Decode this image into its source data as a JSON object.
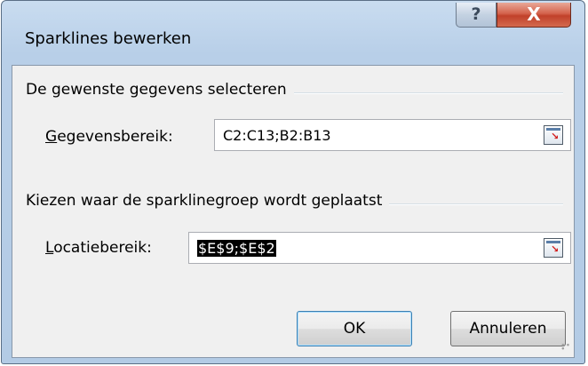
{
  "dialog": {
    "title": "Sparklines bewerken",
    "help_glyph": "?",
    "close_glyph": "X"
  },
  "data_group": {
    "heading": "De gewenste gegevens selecteren",
    "range_label_mnemonic": "G",
    "range_label_rest": "egevensbereik:",
    "range_value": "C2:C13;B2:B13"
  },
  "location_group": {
    "heading": "Kiezen waar de sparklinegroep wordt geplaatst",
    "range_label_mnemonic": "L",
    "range_label_rest": "ocatiebereik:",
    "range_value": "$E$9;$E$2"
  },
  "buttons": {
    "ok": "OK",
    "cancel": "Annuleren"
  },
  "icons": {
    "help": "help-icon",
    "close": "close-icon",
    "collapse_dialog": "collapse-dialog-icon",
    "resize_grip": "resize-grip-icon"
  }
}
